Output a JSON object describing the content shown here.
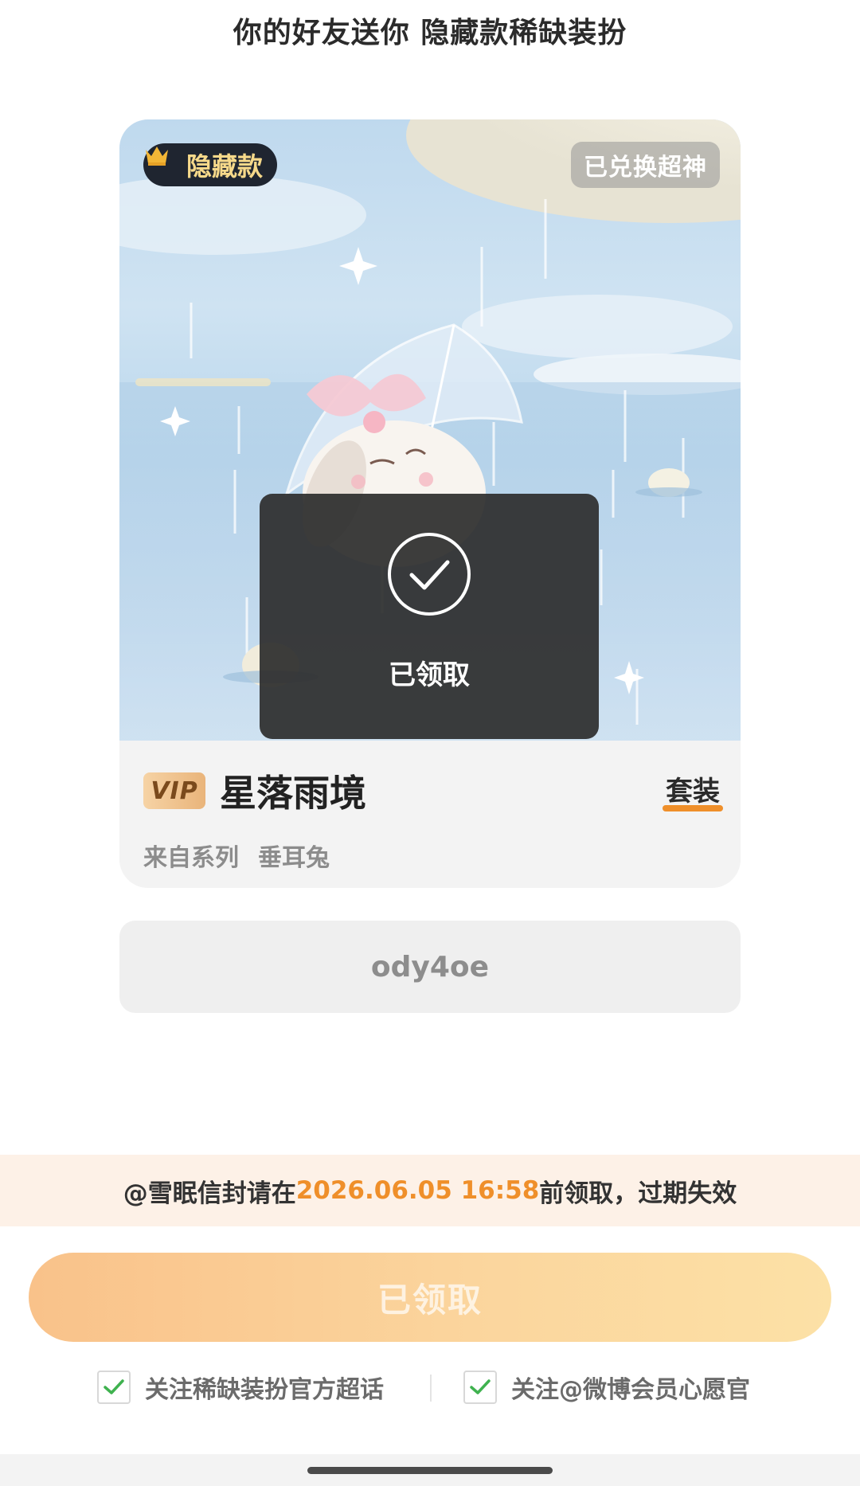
{
  "header": {
    "title": "你的好友送你 隐藏款稀缺装扮"
  },
  "card": {
    "hidden_badge_label": "隐藏款",
    "redeemed_badge_label": "已兑换超神",
    "toast_label": "已领取",
    "vip_label": "VIP",
    "item_name": "星落雨境",
    "item_type": "套装",
    "series_label": "来自系列",
    "series_name": "垂耳兔"
  },
  "code": {
    "value": "ody4oe"
  },
  "notice": {
    "prefix": "@雪眠信封请在",
    "date": "2026.06.05 16:58",
    "suffix": "前领取，过期失效"
  },
  "claim_button": {
    "label": "已领取"
  },
  "options": [
    {
      "label": "关注稀缺装扮官方超话",
      "checked": true
    },
    {
      "label": "关注@微博会员心愿官",
      "checked": true
    }
  ],
  "colors": {
    "accent_orange": "#ef8f2a",
    "check_green": "#3fb24f",
    "toast_bg": "#2d2d2d"
  }
}
